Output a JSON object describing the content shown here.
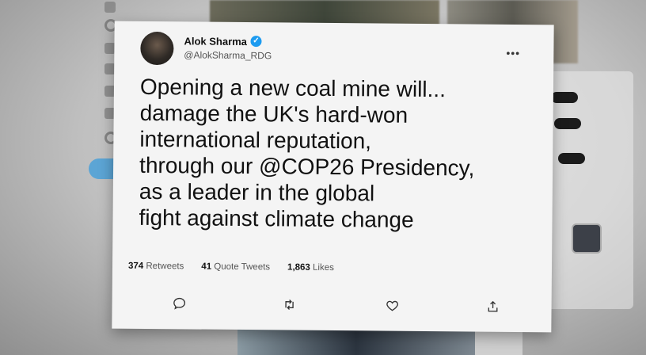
{
  "tweet": {
    "author_name": "Alok Sharma",
    "author_handle": "@AlokSharma_RDG",
    "text_lines": [
      "Opening a new coal mine will...",
      "damage the UK's hard-won",
      "international reputation,",
      "through our @COP26 Presidency,",
      "as a leader in the global",
      "fight against climate change"
    ],
    "stats": {
      "retweets_count": "374",
      "retweets_label": "Retweets",
      "quote_count": "41",
      "quote_label": "Quote Tweets",
      "likes_count": "1,863",
      "likes_label": "Likes"
    }
  },
  "icons": {
    "verified": "verified-badge-icon",
    "more": "more-options-icon",
    "reply": "reply-icon",
    "retweet": "retweet-icon",
    "like": "like-icon",
    "share": "share-icon"
  },
  "colors": {
    "verified": "#1d9bf0",
    "tweet_button": "#4aa0d8"
  }
}
